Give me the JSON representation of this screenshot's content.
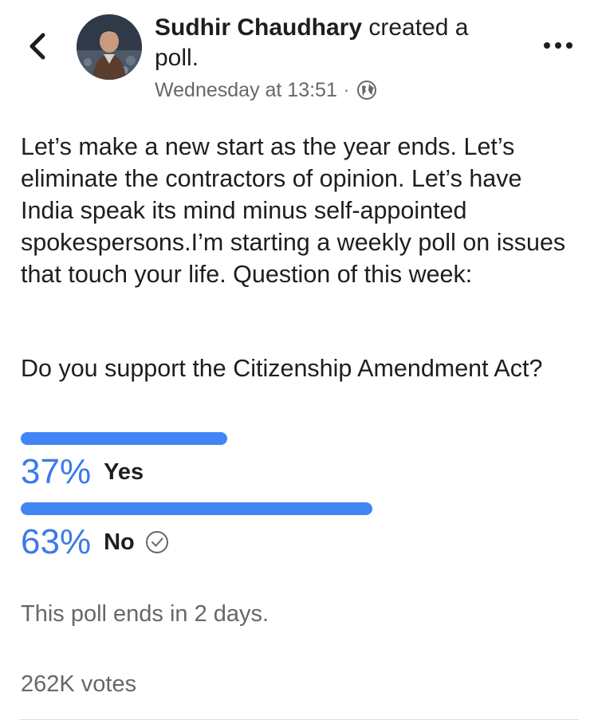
{
  "post": {
    "author": "Sudhir Chaudhary",
    "action": "created a poll.",
    "timestamp": "Wednesday at 13:51",
    "separator": "·",
    "privacy_icon": "globe-icon",
    "body": "Let’s make a new start as the year ends. Let’s eliminate the contractors of opinion. Let’s have India speak its mind minus self-appointed spokespersons.I’m starting a weekly poll on issues that touch your life. Question of this week:",
    "question": "Do you support the Citizenship Amendment Act?"
  },
  "poll": {
    "options": [
      {
        "percent_label": "37%",
        "label": "Yes",
        "percent": 37,
        "selected": false
      },
      {
        "percent_label": "63%",
        "label": "No",
        "percent": 63,
        "selected": true
      }
    ],
    "ends_text": "This poll ends in 2 days.",
    "votes": "262K votes"
  },
  "colors": {
    "accent": "#4285f4",
    "percent_text": "#3b7ae8",
    "secondary_text": "#65676b"
  },
  "icons": {
    "back": "chevron-left-icon",
    "more": "more-horizontal-icon",
    "selected": "check-circle-icon"
  }
}
